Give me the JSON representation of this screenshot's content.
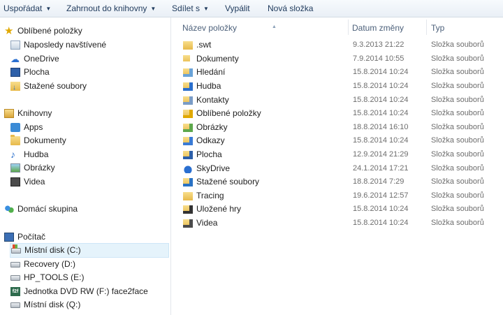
{
  "toolbar": {
    "organize": "Uspořádat",
    "include_in_library": "Zahrnout do knihovny",
    "share": "Sdílet s",
    "burn": "Vypálit",
    "new_folder": "Nová složka"
  },
  "nav": {
    "favorites": {
      "title": "Oblíbené položky",
      "items": [
        {
          "label": "Naposledy navštívené",
          "icon": "recent-places-icon"
        },
        {
          "label": "OneDrive",
          "icon": "onedrive-icon"
        },
        {
          "label": "Plocha",
          "icon": "desktop-icon"
        },
        {
          "label": "Stažené soubory",
          "icon": "downloads-icon"
        }
      ]
    },
    "libraries": {
      "title": "Knihovny",
      "items": [
        {
          "label": "Apps",
          "icon": "apps-icon"
        },
        {
          "label": "Dokumenty",
          "icon": "documents-icon"
        },
        {
          "label": "Hudba",
          "icon": "music-icon"
        },
        {
          "label": "Obrázky",
          "icon": "pictures-icon"
        },
        {
          "label": "Videa",
          "icon": "videos-icon"
        }
      ]
    },
    "homegroup": {
      "title": "Domácí skupina"
    },
    "computer": {
      "title": "Počítač",
      "items": [
        {
          "label": "Místní disk (C:)",
          "icon": "windows-drive-icon",
          "selected": true
        },
        {
          "label": "Recovery (D:)",
          "icon": "drive-icon"
        },
        {
          "label": "HP_TOOLS (E:)",
          "icon": "drive-icon"
        },
        {
          "label": "Jednotka DVD RW (F:) face2face",
          "icon": "dvd-drive-icon"
        },
        {
          "label": "Místní disk (Q:)",
          "icon": "drive-icon"
        }
      ]
    },
    "dvd_badge": "f2f"
  },
  "columns": {
    "name": "Název položky",
    "date": "Datum změny",
    "type": "Typ"
  },
  "files": [
    {
      "name": ".swt",
      "date": "9.3.2013 21:22",
      "type": "Složka souborů",
      "icon": "folder-icon"
    },
    {
      "name": "Dokumenty",
      "date": "7.9.2014 10:55",
      "type": "Složka souborů",
      "icon": "documents-folder-icon"
    },
    {
      "name": "Hledání",
      "date": "15.8.2014 10:24",
      "type": "Složka souborů",
      "icon": "searches-folder-icon"
    },
    {
      "name": "Hudba",
      "date": "15.8.2014 10:24",
      "type": "Složka souborů",
      "icon": "music-folder-icon"
    },
    {
      "name": "Kontakty",
      "date": "15.8.2014 10:24",
      "type": "Složka souborů",
      "icon": "contacts-folder-icon"
    },
    {
      "name": "Oblíbené položky",
      "date": "15.8.2014 10:24",
      "type": "Složka souborů",
      "icon": "favorites-folder-icon"
    },
    {
      "name": "Obrázky",
      "date": "18.8.2014 16:10",
      "type": "Složka souborů",
      "icon": "pictures-folder-icon"
    },
    {
      "name": "Odkazy",
      "date": "15.8.2014 10:24",
      "type": "Složka souborů",
      "icon": "links-folder-icon"
    },
    {
      "name": "Plocha",
      "date": "12.9.2014 21:29",
      "type": "Složka souborů",
      "icon": "desktop-folder-icon"
    },
    {
      "name": "SkyDrive",
      "date": "24.1.2014 17:21",
      "type": "Složka souborů",
      "icon": "skydrive-icon"
    },
    {
      "name": "Stažené soubory",
      "date": "18.8.2014 7:29",
      "type": "Složka souborů",
      "icon": "downloads-folder-icon"
    },
    {
      "name": "Tracing",
      "date": "19.6.2014 12:57",
      "type": "Složka souborů",
      "icon": "folder-icon"
    },
    {
      "name": "Uložené hry",
      "date": "15.8.2014 10:24",
      "type": "Složka souborů",
      "icon": "saved-games-folder-icon"
    },
    {
      "name": "Videa",
      "date": "15.8.2014 10:24",
      "type": "Složka souborů",
      "icon": "videos-folder-icon"
    }
  ]
}
